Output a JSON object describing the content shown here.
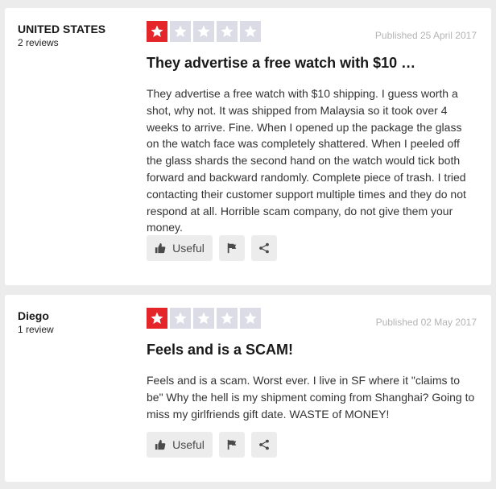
{
  "reviews": [
    {
      "reviewer_name": "UNITED STATES",
      "review_count": "2 reviews",
      "rating": 1,
      "published": "Published 25 April 2017",
      "title": "They advertise a free watch with $10 …",
      "body": "They advertise a free watch with $10 shipping. I guess worth a shot, why not. It was shipped from Malaysia so it took over 4 weeks to arrive. Fine. When I opened up the package the glass on the watch face was completely shattered. When I peeled off the glass shards the second hand on the watch would tick both forward and backward randomly. Complete piece of trash. I tried contacting their customer support multiple times and they do not respond at all. Horrible scam company, do not give them your money.",
      "useful_label": "Useful"
    },
    {
      "reviewer_name": "Diego",
      "review_count": "1 review",
      "rating": 1,
      "published": "Published 02 May 2017",
      "title": "Feels and is a SCAM!",
      "body": "Feels and is a scam. Worst ever. I live in SF where it \"claims to be\" Why the hell is my shipment coming from Shanghai? Going to miss my girlfriends gift date. WASTE of MONEY!",
      "useful_label": "Useful"
    }
  ],
  "icons": {
    "star": "star-icon",
    "useful": "thumbs-up-icon",
    "flag": "flag-icon",
    "share": "share-icon"
  },
  "colors": {
    "star_active": "#e4262a",
    "star_inactive": "#dcdce6",
    "background": "#ececec",
    "card": "#ffffff"
  }
}
